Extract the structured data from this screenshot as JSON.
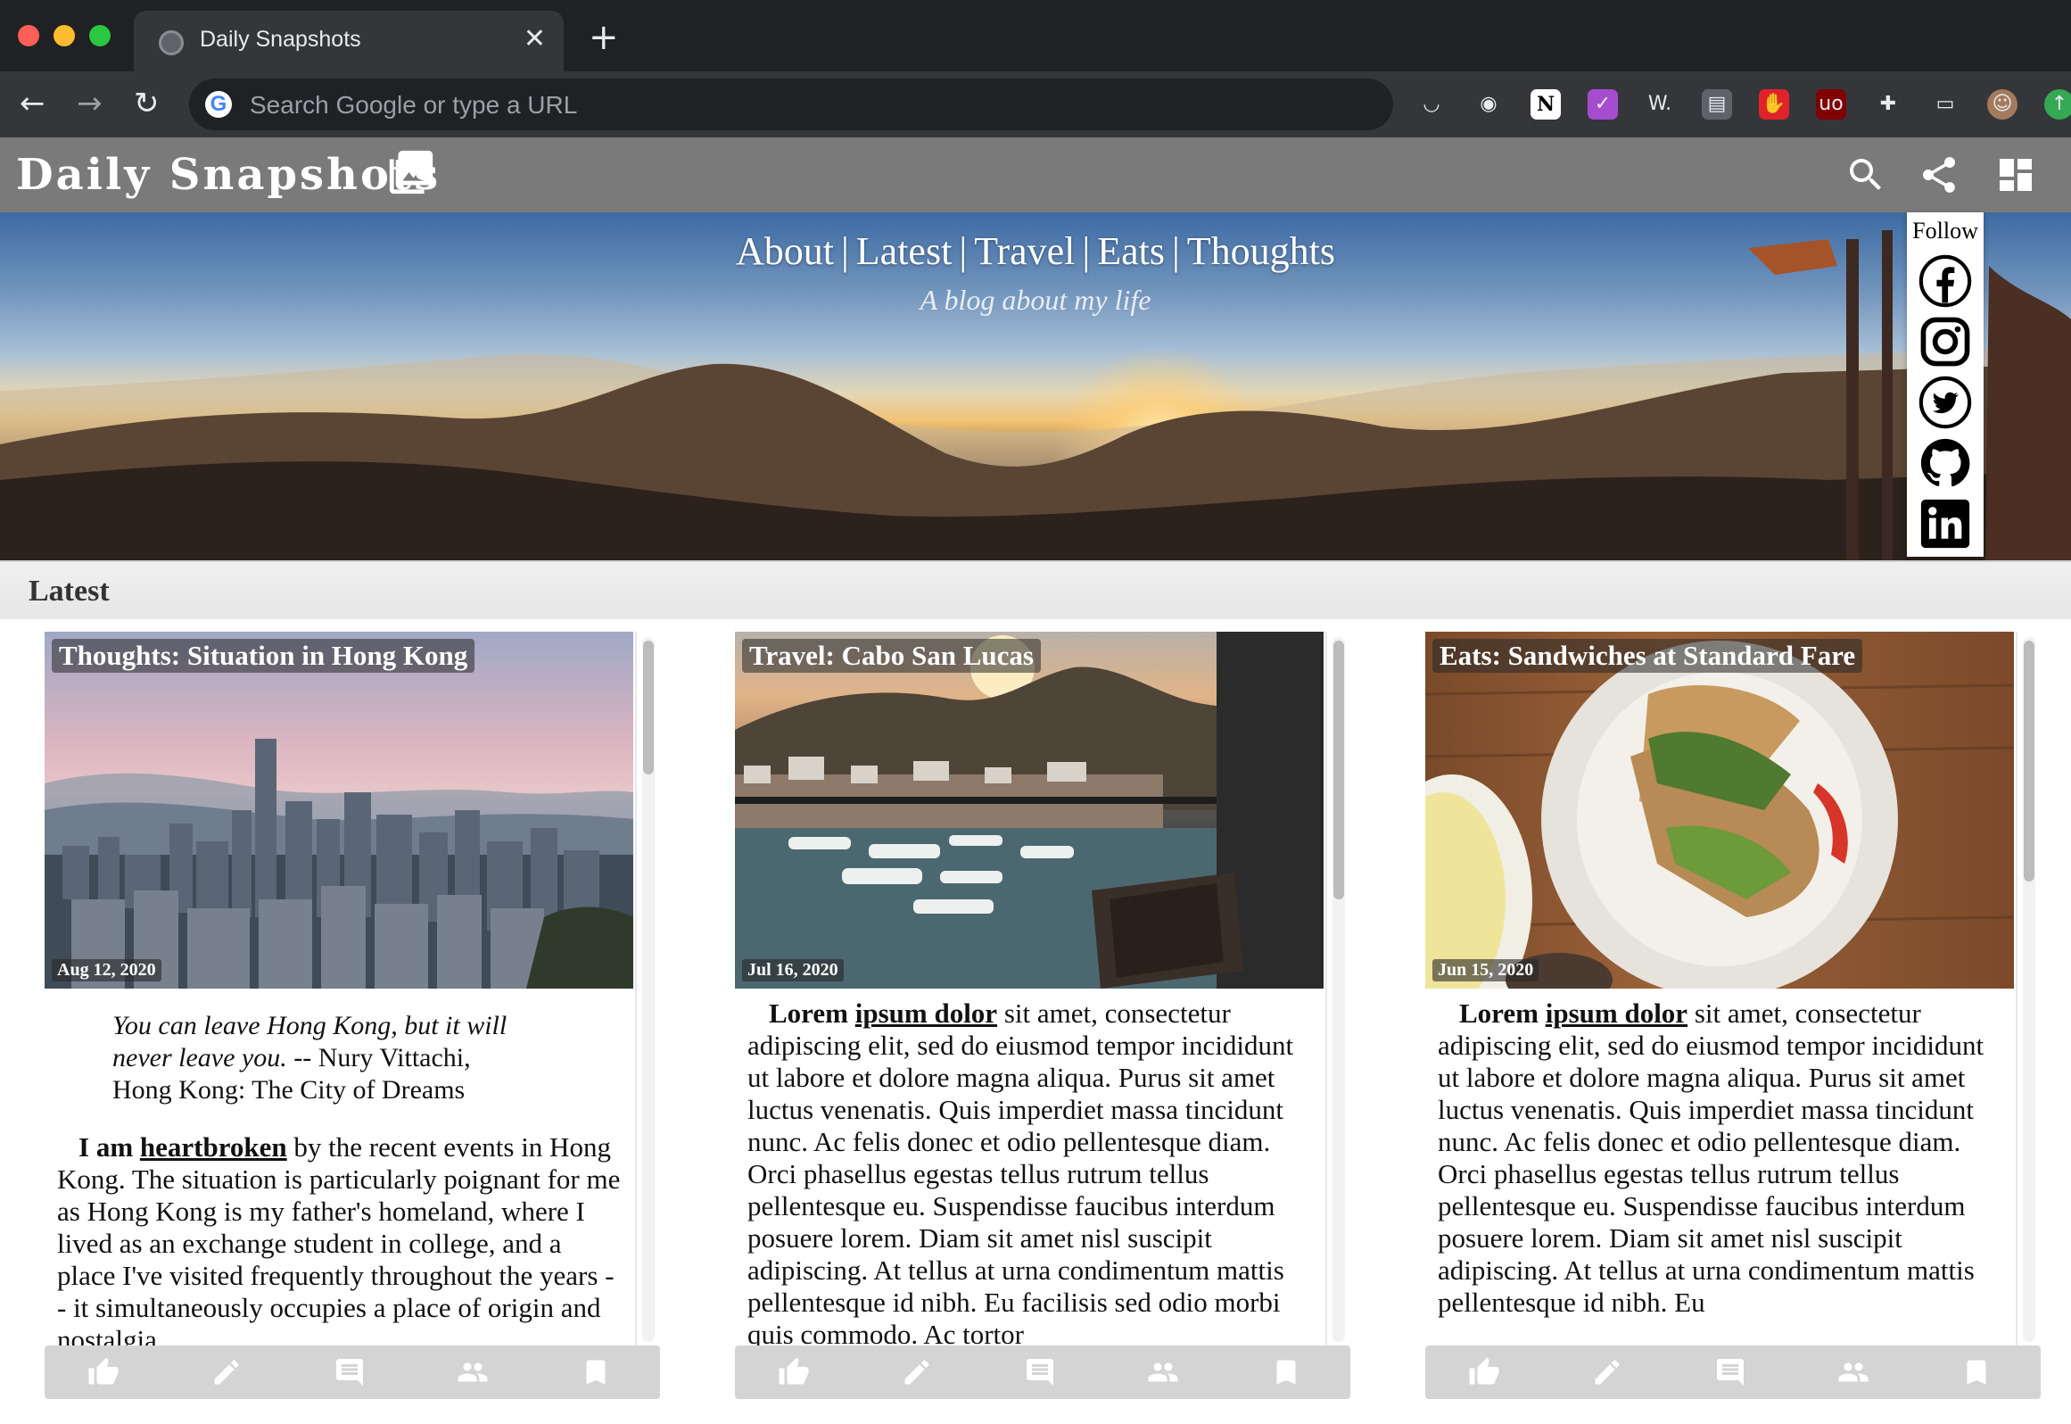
{
  "browser": {
    "tab_title": "Daily Snapshots",
    "tab_close": "✕",
    "new_tab": "+",
    "back": "←",
    "forward": "→",
    "reload": "↻",
    "google_g": "G",
    "omnibox_placeholder": "Search Google or type a URL",
    "extensions": [
      {
        "name": "pocket-icon",
        "glyph": "◡",
        "color": "#35363a"
      },
      {
        "name": "shield-icon",
        "glyph": "◉",
        "color": "#35363a"
      },
      {
        "name": "notion-icon",
        "glyph": "N",
        "color": "#ffffff"
      },
      {
        "name": "toggl-icon",
        "glyph": "✓",
        "color": "#a64dcf"
      },
      {
        "name": "wordtune-icon",
        "glyph": "W.",
        "color": "#35363a"
      },
      {
        "name": "extension-doc-icon",
        "glyph": "▤",
        "color": "#5f6368"
      },
      {
        "name": "stop-hand-icon",
        "glyph": "✋",
        "color": "#e0222b"
      },
      {
        "name": "ublock-icon",
        "glyph": "uo",
        "color": "#800000"
      },
      {
        "name": "puzzle-icon",
        "glyph": "✚",
        "color": "#35363a"
      },
      {
        "name": "cast-icon",
        "glyph": "▭",
        "color": "#35363a"
      },
      {
        "name": "profile-avatar",
        "glyph": "☺",
        "color": "#a37b5c"
      },
      {
        "name": "update-icon",
        "glyph": "↑",
        "color": "#34a853"
      }
    ]
  },
  "header": {
    "title": "Daily Snapshots"
  },
  "hero": {
    "nav": [
      "About",
      "Latest",
      "Travel",
      "Eats",
      "Thoughts"
    ],
    "separator": "|",
    "tagline": "A blog about my life"
  },
  "follow": {
    "label": "Follow",
    "links": [
      "facebook",
      "instagram",
      "twitter",
      "github",
      "linkedin"
    ]
  },
  "latest": {
    "title": "Latest"
  },
  "cards": [
    {
      "label": "Thoughts: Situation in Hong Kong",
      "date": "Aug 12, 2020",
      "quote_lines": [
        "You can leave Hong Kong, but it will",
        "never leave you.",
        " -- Nury Vittachi,",
        "Hong Kong: The City of Dreams"
      ],
      "lead": "I am",
      "link": "heartbroken",
      "text": " by the recent events in Hong Kong. The situation is particularly poignant for me as Hong Kong is my father's homeland, where I lived as an exchange student in college, and a place I've visited frequently throughout the years -- it simultaneously occupies a place of origin and nostalgia."
    },
    {
      "label": "Travel: Cabo San Lucas",
      "date": "Jul 16, 2020",
      "lead": "Lorem",
      "link": "ipsum dolor",
      "text": " sit amet, consectetur adipiscing elit, sed do eiusmod tempor incididunt ut labore et dolore magna aliqua. Purus sit amet luctus venenatis. Quis imperdiet massa tincidunt nunc. Ac felis donec et odio pellentesque diam. Orci phasellus egestas tellus rutrum tellus pellentesque eu. Suspendisse faucibus interdum posuere lorem. Diam sit amet nisl suscipit adipiscing. At tellus at urna condimentum mattis pellentesque id nibh. Eu facilisis sed odio morbi quis commodo. Ac tortor"
    },
    {
      "label": "Eats: Sandwiches at Standard Fare",
      "date": "Jun 15, 2020",
      "lead": "Lorem",
      "link": "ipsum dolor",
      "text": " sit amet, consectetur adipiscing elit, sed do eiusmod tempor incididunt ut labore et dolore magna aliqua. Purus sit amet luctus venenatis. Quis imperdiet massa tincidunt nunc. Ac felis donec et odio pellentesque diam. Orci phasellus egestas tellus rutrum tellus pellentesque eu. Suspendisse faucibus interdum posuere lorem. Diam sit amet nisl suscipit adipiscing. At tellus at urna condimentum mattis pellentesque id nibh. Eu"
    }
  ],
  "card_actions": [
    "thumbs-up-icon",
    "pencil-icon",
    "comment-icon",
    "people-icon",
    "bookmark-icon"
  ],
  "colors": {
    "header_bg": "#7a7a7a",
    "action_bar": "#d4d4d4"
  }
}
